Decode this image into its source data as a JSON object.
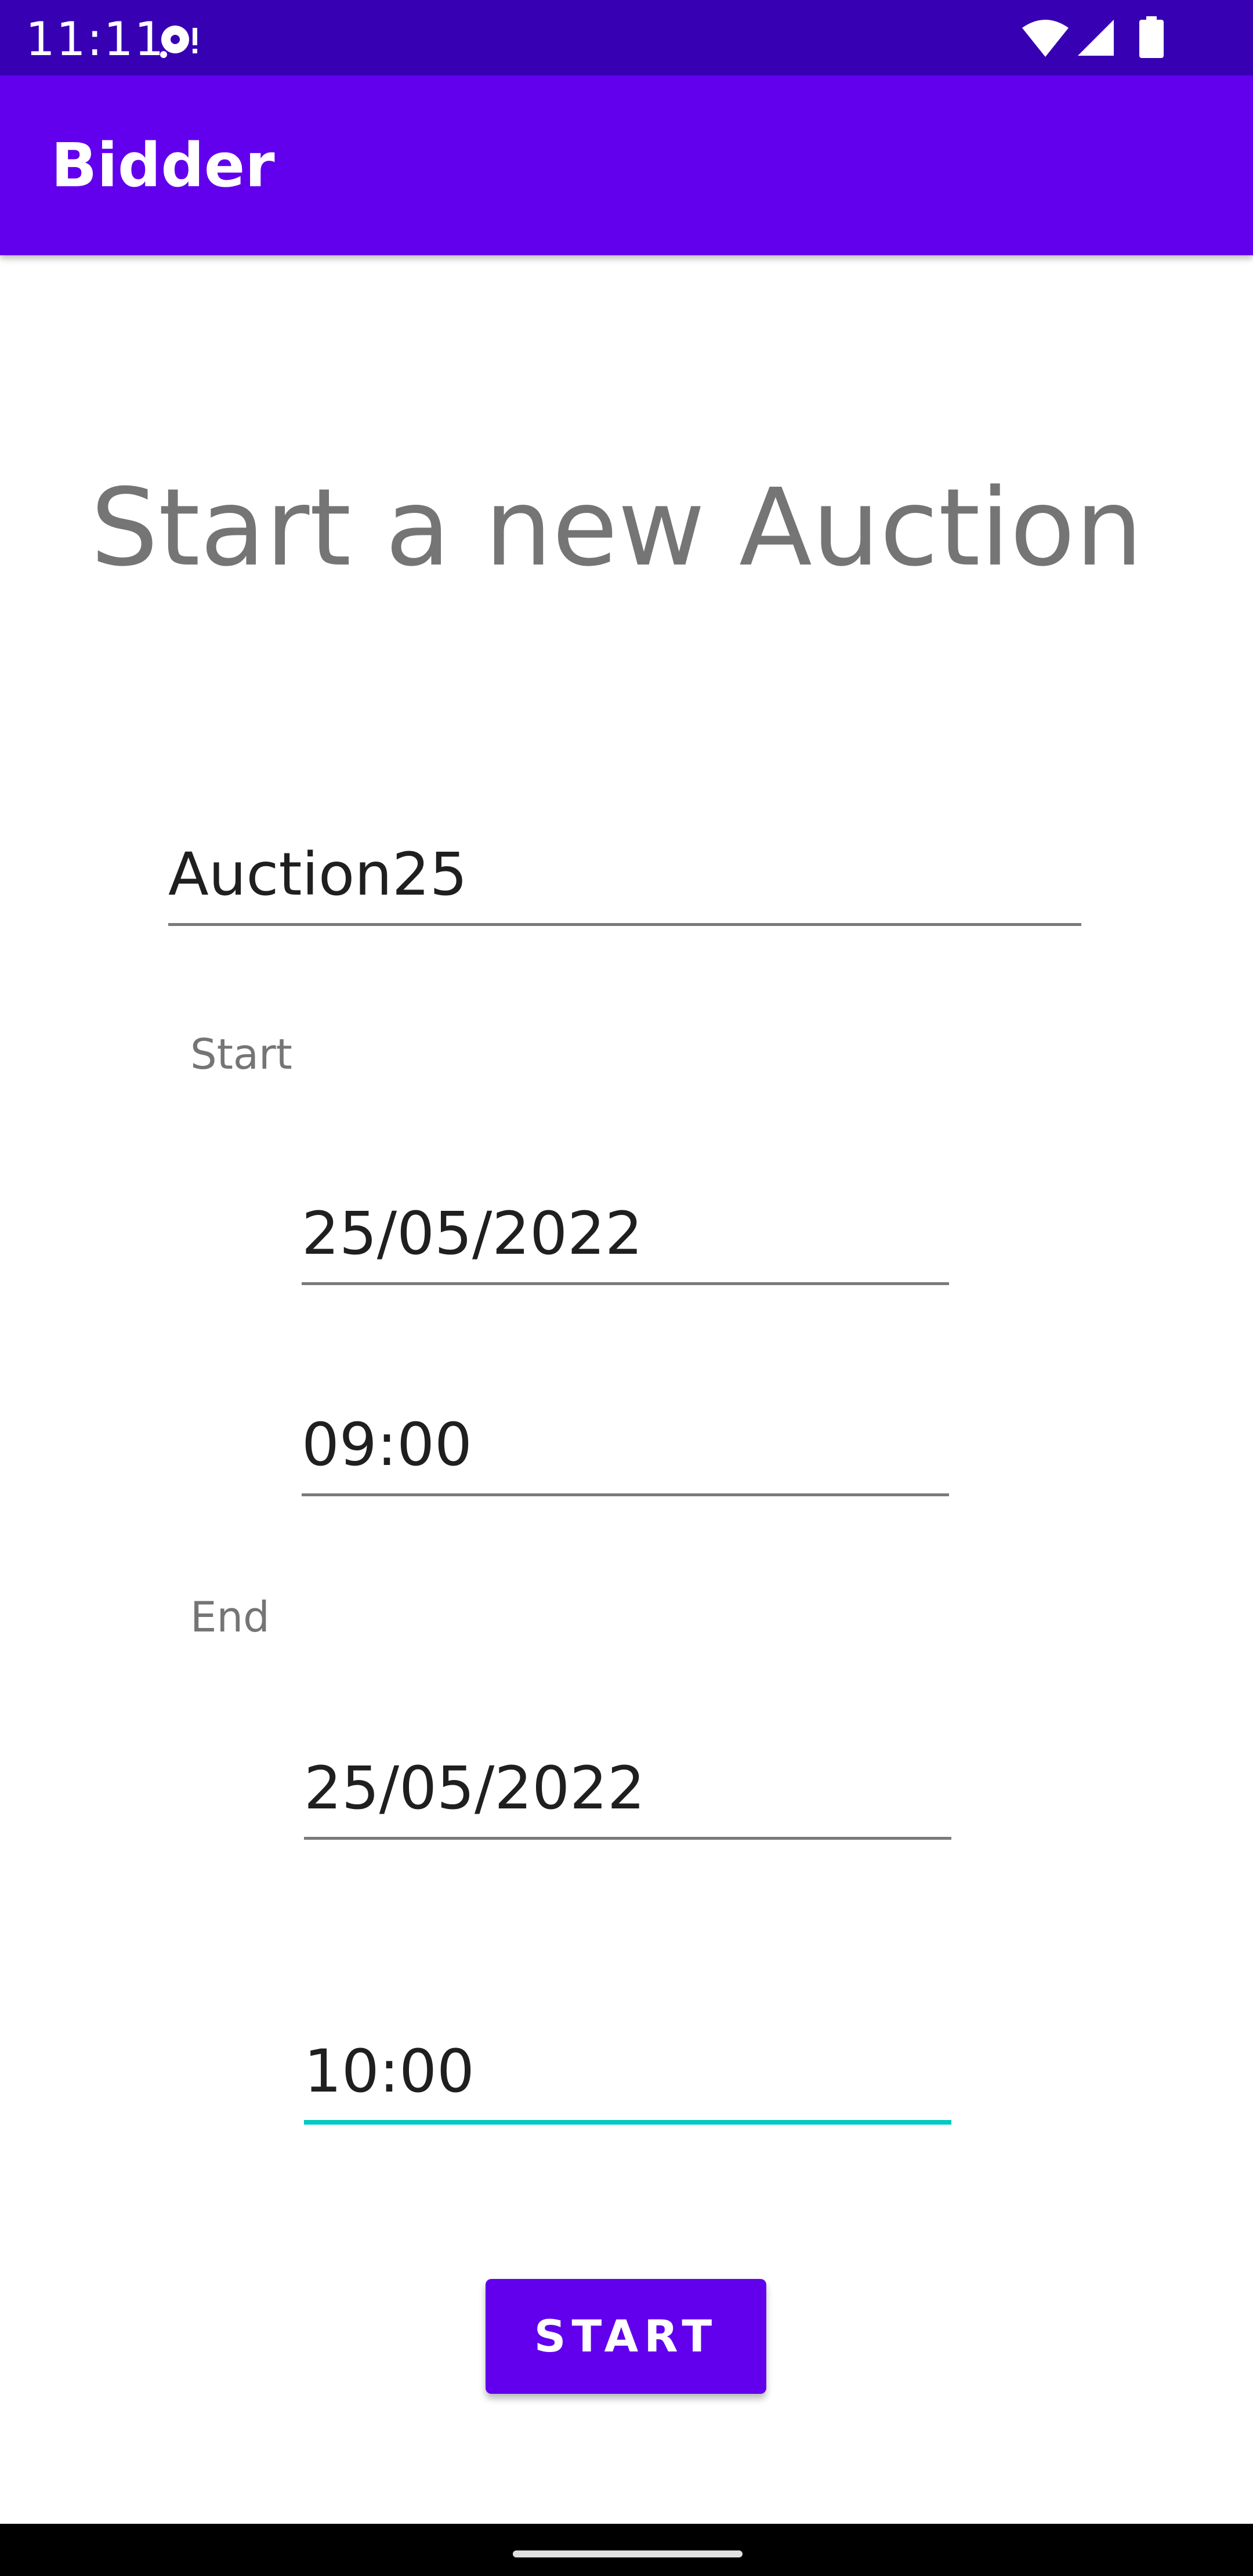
{
  "status_bar": {
    "time": "11:11",
    "icons": [
      "notification-icon",
      "wifi-icon",
      "signal-icon",
      "battery-icon"
    ]
  },
  "app_bar": {
    "title": "Bidder",
    "color": "#6200ee"
  },
  "form": {
    "heading": "Start a new Auction",
    "name_value": "Auction25",
    "start_label": "Start",
    "start_date": "25/05/2022",
    "start_time": "09:00",
    "end_label": "End",
    "end_date": "25/05/2022",
    "end_time": "10:00",
    "submit_label": "START"
  },
  "colors": {
    "accent": "#6200ee",
    "status_bar": "#3700b3",
    "focus_underline": "#03c9c4"
  }
}
